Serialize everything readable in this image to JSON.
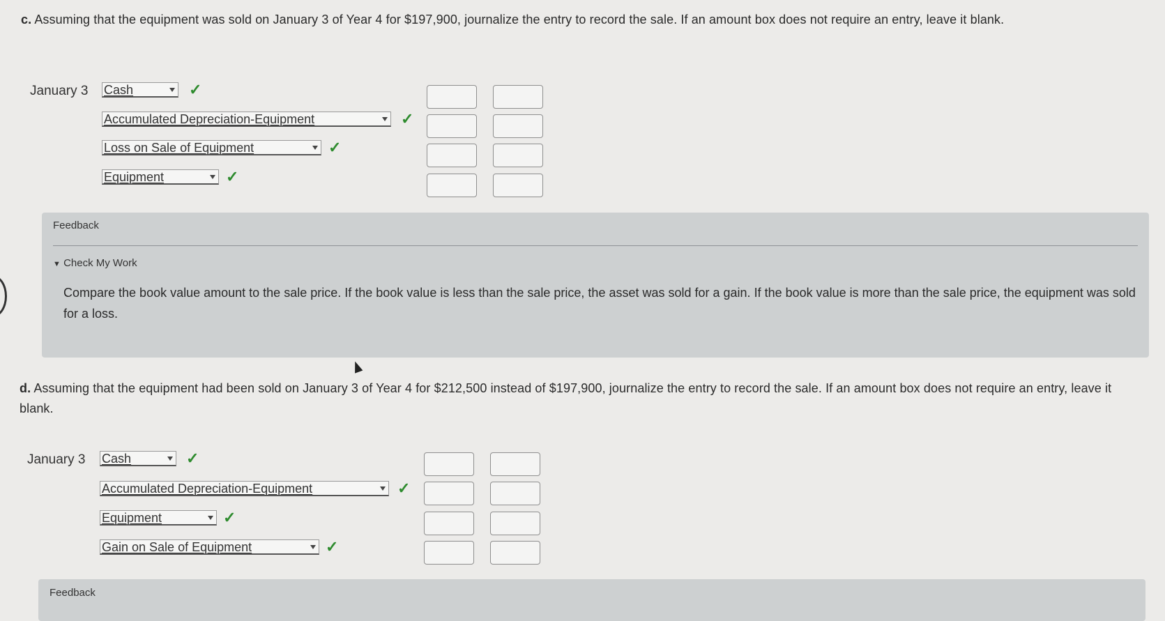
{
  "part_c": {
    "prefix": "c.",
    "question": "Assuming that the equipment was sold on January 3 of Year 4 for $197,900, journalize the entry to record the sale. If an amount box does not require an entry, leave it blank.",
    "date": "January 3",
    "rows": [
      "Cash",
      "Accumulated Depreciation-Equipment",
      "Loss on Sale of Equipment",
      "Equipment"
    ],
    "feedback": {
      "title": "Feedback",
      "toggle": "Check My Work",
      "text": "Compare the book value amount to the sale price. If the book value is less than the sale price, the asset was sold for a gain. If the book value is more than the sale price, the equipment was sold for a loss."
    }
  },
  "part_d": {
    "prefix": "d.",
    "question": "Assuming that the equipment had been sold on January 3 of Year 4 for $212,500 instead of $197,900, journalize the entry to record the sale. If an amount box does not require an entry, leave it blank.",
    "date": "January 3",
    "rows": [
      "Cash",
      "Accumulated Depreciation-Equipment",
      "Equipment",
      "Gain on Sale of Equipment"
    ],
    "feedback": {
      "title": "Feedback"
    }
  },
  "colors": {
    "check": "#2e8b2e",
    "feedback_bg": "#cdd0d1"
  },
  "icons": {
    "check": "checkmark-icon",
    "dropdown": "dropdown-arrow-icon"
  }
}
